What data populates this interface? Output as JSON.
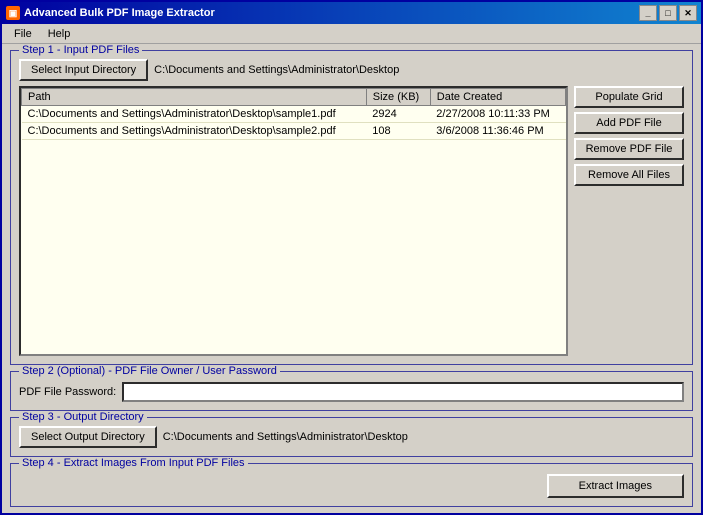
{
  "window": {
    "title": "Advanced Bulk PDF Image Extractor",
    "min_label": "_",
    "max_label": "□",
    "close_label": "✕"
  },
  "menu": {
    "file_label": "File",
    "help_label": "Help"
  },
  "step1": {
    "label": "Step 1 - Input PDF Files",
    "select_btn": "Select Input Directory",
    "input_path": "C:\\Documents and Settings\\Administrator\\Desktop",
    "table": {
      "col_path": "Path",
      "col_size": "Size (KB)",
      "col_date": "Date Created",
      "rows": [
        {
          "path": "C:\\Documents and Settings\\Administrator\\Desktop\\sample1.pdf",
          "size": "2924",
          "date": "2/27/2008 10:11:33 PM"
        },
        {
          "path": "C:\\Documents and Settings\\Administrator\\Desktop\\sample2.pdf",
          "size": "108",
          "date": "3/6/2008 11:36:46 PM"
        }
      ]
    },
    "populate_btn": "Populate Grid",
    "add_btn": "Add PDF File",
    "remove_btn": "Remove PDF File",
    "remove_all_btn": "Remove All Files"
  },
  "step2": {
    "label": "Step 2 (Optional) - PDF File Owner / User Password",
    "password_label": "PDF File Password:",
    "password_placeholder": ""
  },
  "step3": {
    "label": "Step 3 - Output Directory",
    "select_btn": "Select Output Directory",
    "output_path": "C:\\Documents and Settings\\Administrator\\Desktop"
  },
  "step4": {
    "label": "Step 4 - Extract Images From Input PDF Files",
    "extract_btn": "Extract Images"
  }
}
